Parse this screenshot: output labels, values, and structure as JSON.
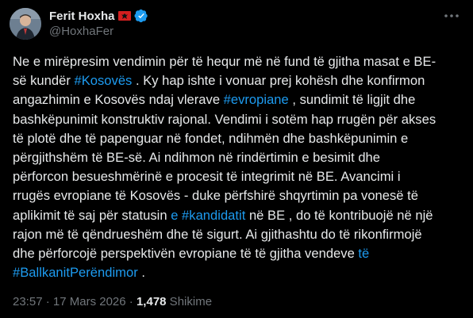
{
  "author": {
    "name": "Ferit Hoxha",
    "handle": "@HoxhaFer",
    "flag_icon": "albania-flag-icon",
    "verified_icon": "verified-badge-icon",
    "verified_color": "#1d9bf0"
  },
  "more_icon": "more-horizontal-icon",
  "tweet": {
    "lines": [
      [
        {
          "t": "Ne e mirëpresim vendimin për të hequr më në fund të gjitha masat e BE-"
        }
      ],
      [
        {
          "t": "së kundër "
        },
        {
          "t": "#Kosovës",
          "tag": true
        },
        {
          "t": " . Ky hap ishte i vonuar prej kohësh dhe konfirmon"
        }
      ],
      [
        {
          "t": "angazhimin e Kosovës ndaj vlerave "
        },
        {
          "t": "#evropiane",
          "tag": true
        },
        {
          "t": " , sundimit të ligjit dhe"
        }
      ],
      [
        {
          "t": "bashkëpunimit konstruktiv rajonal. Vendimi i sotëm hap rrugën për akses"
        }
      ],
      [
        {
          "t": "të plotë dhe të papenguar në fondet, ndihmën dhe bashkëpunimin e"
        }
      ],
      [
        {
          "t": "përgjithshëm të BE-së. Ai ndihmon në rindërtimin e besimit dhe"
        }
      ],
      [
        {
          "t": "përforcon besueshmërinë e procesit të integrimit në BE. Avancimi i"
        }
      ],
      [
        {
          "t": "rrugës evropiane të Kosovës - duke përfshirë shqyrtimin pa vonesë të"
        }
      ],
      [
        {
          "t": "aplikimit të saj për statusin "
        },
        {
          "t": "e #kandidatit",
          "tag": true
        },
        {
          "t": " në BE , do të kontribuojë në një"
        }
      ],
      [
        {
          "t": "rajon më të qëndrueshëm dhe të sigurt. Ai gjithashtu do të rikonfirmojë"
        }
      ],
      [
        {
          "t": "dhe përforcojë perspektivën evropiane të të gjitha vendeve "
        },
        {
          "t": "të",
          "tag": true
        }
      ],
      [
        {
          "t": "#BallkanitPerëndimor",
          "tag": true
        },
        {
          "t": " ."
        }
      ]
    ]
  },
  "meta": {
    "time": "23:57",
    "sep1": " · ",
    "date": "17 Mars 2026",
    "sep2": " · ",
    "views": "1,478",
    "views_label": " Shikime"
  },
  "colors": {
    "background": "#000000",
    "text": "#e7e9ea",
    "secondary": "#71767b",
    "accent": "#1d9bf0"
  }
}
